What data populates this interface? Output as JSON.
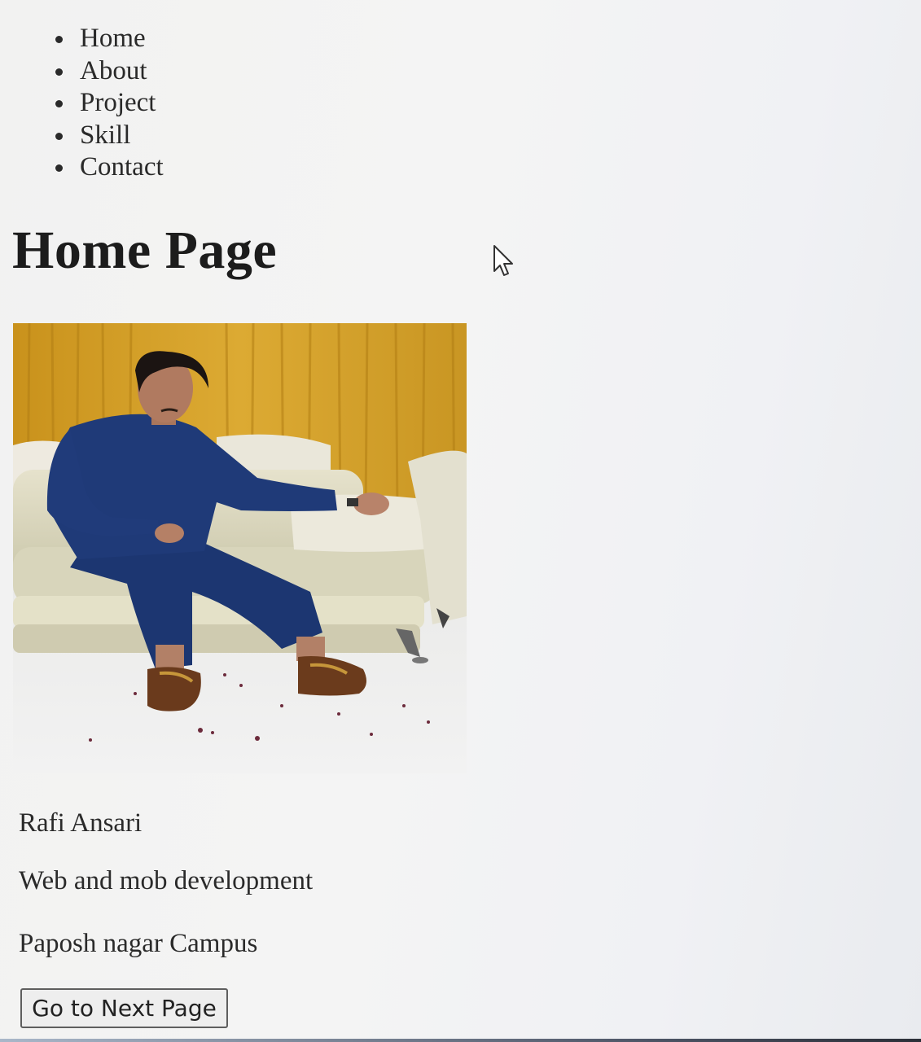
{
  "nav": {
    "items": [
      {
        "label": "Home"
      },
      {
        "label": "About"
      },
      {
        "label": "Project"
      },
      {
        "label": "Skill"
      },
      {
        "label": "Contact"
      }
    ]
  },
  "main": {
    "title": "Home Page",
    "photo_alt": "Portrait photo",
    "name": "Rafi Ansari",
    "role": "Web and mob development",
    "campus": "Paposh nagar Campus",
    "next_button_label": "Go to Next Page"
  },
  "icons": {
    "cursor": "arrow-cursor-icon",
    "bullet": "disc-bullet"
  },
  "colors": {
    "text": "#222222",
    "background": "#f3f3f3",
    "curtain": "#d9a82b",
    "shirt": "#1f3a78"
  }
}
